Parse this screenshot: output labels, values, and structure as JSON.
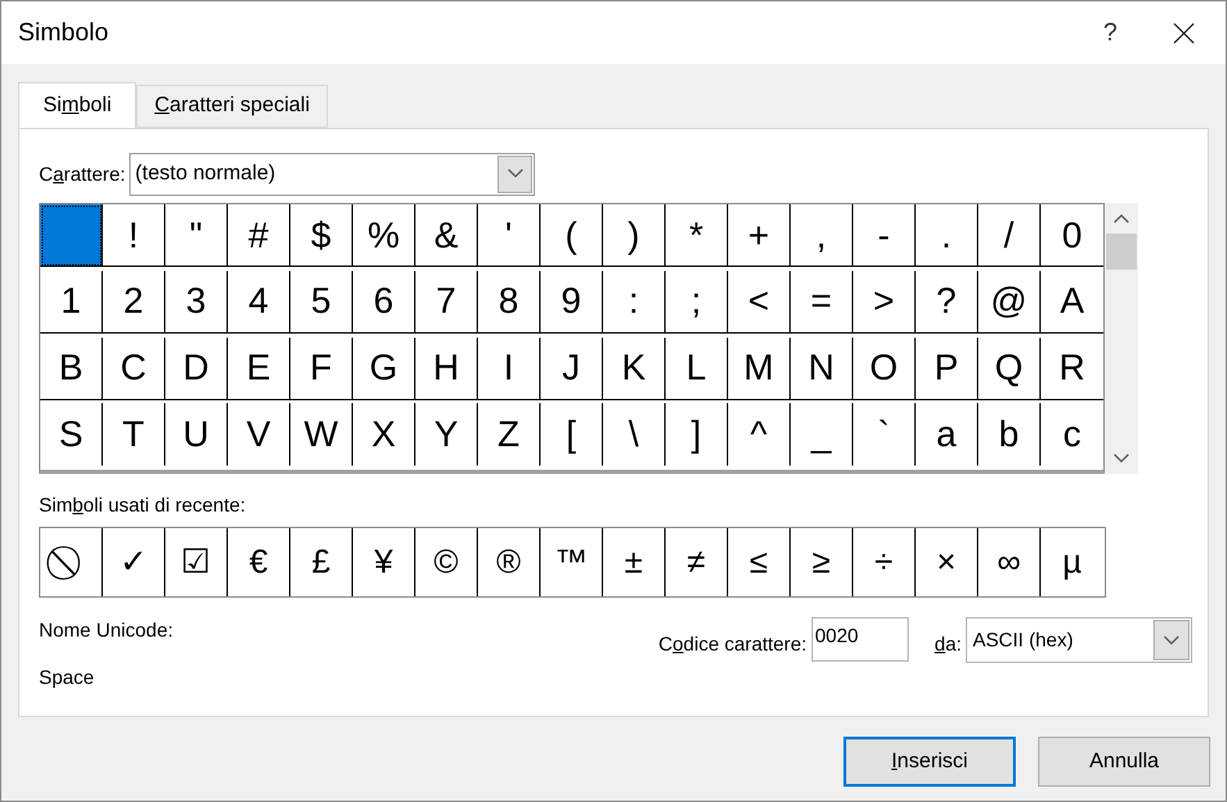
{
  "window": {
    "title": "Simbolo",
    "help_button": "?"
  },
  "tabs": [
    {
      "before": "Si",
      "key": "m",
      "after": "boli",
      "selected": true
    },
    {
      "key": "C",
      "after": "aratteri speciali",
      "selected": false
    }
  ],
  "font_field": {
    "label": {
      "before": "C",
      "key": "a",
      "after": "rattere:"
    },
    "value": "(testo normale)"
  },
  "symbol_grid": [
    {
      "selected": true
    },
    {
      "char": "!",
      "selected": false
    },
    {
      "char": "\"",
      "selected": false
    },
    {
      "char": "#",
      "selected": false
    },
    {
      "char": "$",
      "selected": false
    },
    {
      "char": "%",
      "selected": false
    },
    {
      "char": "&",
      "selected": false
    },
    {
      "char": "'",
      "selected": false
    },
    {
      "char": "(",
      "selected": false
    },
    {
      "char": ")",
      "selected": false
    },
    {
      "char": "*",
      "selected": false
    },
    {
      "char": "+",
      "selected": false
    },
    {
      "char": ",",
      "selected": false
    },
    {
      "char": "-",
      "selected": false
    },
    {
      "char": ".",
      "selected": false
    },
    {
      "char": "/",
      "selected": false
    },
    {
      "char": "0",
      "selected": false
    },
    {
      "char": "1",
      "selected": false
    },
    {
      "char": "2",
      "selected": false
    },
    {
      "char": "3",
      "selected": false
    },
    {
      "char": "4",
      "selected": false
    },
    {
      "char": "5",
      "selected": false
    },
    {
      "char": "6",
      "selected": false
    },
    {
      "char": "7",
      "selected": false
    },
    {
      "char": "8",
      "selected": false
    },
    {
      "char": "9",
      "selected": false
    },
    {
      "char": ":",
      "selected": false
    },
    {
      "char": ";",
      "selected": false
    },
    {
      "char": "<",
      "selected": false
    },
    {
      "char": "=",
      "selected": false
    },
    {
      "char": ">",
      "selected": false
    },
    {
      "char": "?",
      "selected": false
    },
    {
      "char": "@",
      "selected": false
    },
    {
      "char": "A",
      "selected": false
    },
    {
      "char": "B",
      "selected": false
    },
    {
      "char": "C",
      "selected": false
    },
    {
      "char": "D",
      "selected": false
    },
    {
      "char": "E",
      "selected": false
    },
    {
      "char": "F",
      "selected": false
    },
    {
      "char": "G",
      "selected": false
    },
    {
      "char": "H",
      "selected": false
    },
    {
      "char": "I",
      "selected": false
    },
    {
      "char": "J",
      "selected": false
    },
    {
      "char": "K",
      "selected": false
    },
    {
      "char": "L",
      "selected": false
    },
    {
      "char": "M",
      "selected": false
    },
    {
      "char": "N",
      "selected": false
    },
    {
      "char": "O",
      "selected": false
    },
    {
      "char": "P",
      "selected": false
    },
    {
      "char": "Q",
      "selected": false
    },
    {
      "char": "R",
      "selected": false
    },
    {
      "char": "S",
      "selected": false
    },
    {
      "char": "T",
      "selected": false
    },
    {
      "char": "U",
      "selected": false
    },
    {
      "char": "V",
      "selected": false
    },
    {
      "char": "W",
      "selected": false
    },
    {
      "char": "X",
      "selected": false
    },
    {
      "char": "Y",
      "selected": false
    },
    {
      "char": "Z",
      "selected": false
    },
    {
      "char": "[",
      "selected": false
    },
    {
      "char": "\\",
      "selected": false
    },
    {
      "char": "]",
      "selected": false
    },
    {
      "char": "^",
      "selected": false
    },
    {
      "char": "_",
      "selected": false
    },
    {
      "char": "`",
      "selected": false
    },
    {
      "char": "a",
      "selected": false
    },
    {
      "char": "b",
      "selected": false
    },
    {
      "char": "c",
      "selected": false
    }
  ],
  "recent": {
    "label": {
      "before": "Sim",
      "key": "b",
      "after": "oli usati di recente:"
    },
    "symbols": [
      "⃠",
      "✓",
      "☑",
      "€",
      "£",
      "¥",
      "©",
      "®",
      "™",
      "±",
      "≠",
      "≤",
      "≥",
      "÷",
      "×",
      "∞",
      "µ"
    ]
  },
  "unicode_name": {
    "label": "Nome Unicode:",
    "value": "Space"
  },
  "char_code": {
    "label": {
      "before": "C",
      "key": "o",
      "after": "dice carattere:"
    },
    "value": "0020"
  },
  "from": {
    "label": {
      "key": "d",
      "after": "a:"
    },
    "value": "ASCII (hex)"
  },
  "buttons": [
    {
      "key": "I",
      "after": "nserisci",
      "default": true
    },
    {
      "after": "Annulla",
      "default": false
    }
  ]
}
